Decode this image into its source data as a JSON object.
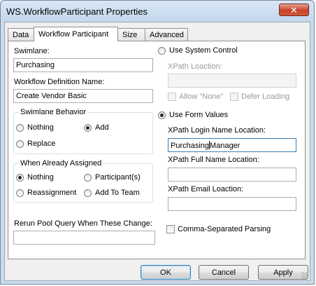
{
  "window": {
    "title": "WS.WorkflowParticipant Properties",
    "close_glyph": "✕"
  },
  "tabs": [
    "Data",
    "Workflow Participant",
    "Size",
    "Advanced"
  ],
  "left": {
    "swimlane_label": "Swimlane:",
    "swimlane_value": "Purchasing",
    "workflow_def_label": "Workflow Definition Name:",
    "workflow_def_value": "Create Vendor Basic",
    "swimlane_behavior": {
      "legend": "Swimlane Behavior",
      "options": [
        "Nothing",
        "Add",
        "Replace"
      ],
      "selected": "Add"
    },
    "when_assigned": {
      "legend": "When Already Assigned",
      "options": [
        "Nothing",
        "Participant(s)",
        "Reassignment",
        "Add To Team"
      ],
      "selected": "Nothing"
    },
    "rerun_label": "Rerun Pool Query When These Change:",
    "rerun_value": ""
  },
  "right": {
    "use_system_control": "Use System Control",
    "xpath_location_label": "XPath Loaction:",
    "xpath_location_value": "",
    "allow_none": "Allow \"None\"",
    "defer_loading": "Defer Loading",
    "use_form_values": "Use Form Values",
    "login_label": "XPath Login Name Location:",
    "login_value_before_caret": "Purchasing",
    "login_value_after_caret": "Manager",
    "fullname_label": "XPath Full Name Location:",
    "fullname_value": "",
    "email_label": "XPath Email Loaction:",
    "email_value": "",
    "comma_parsing": "Comma-Separated Parsing",
    "selected_source": "Use Form Values"
  },
  "buttons": {
    "ok": "OK",
    "cancel": "Cancel",
    "apply": "Apply"
  },
  "icons": {
    "close": "close-icon",
    "resize": "resize-grip-icon"
  }
}
